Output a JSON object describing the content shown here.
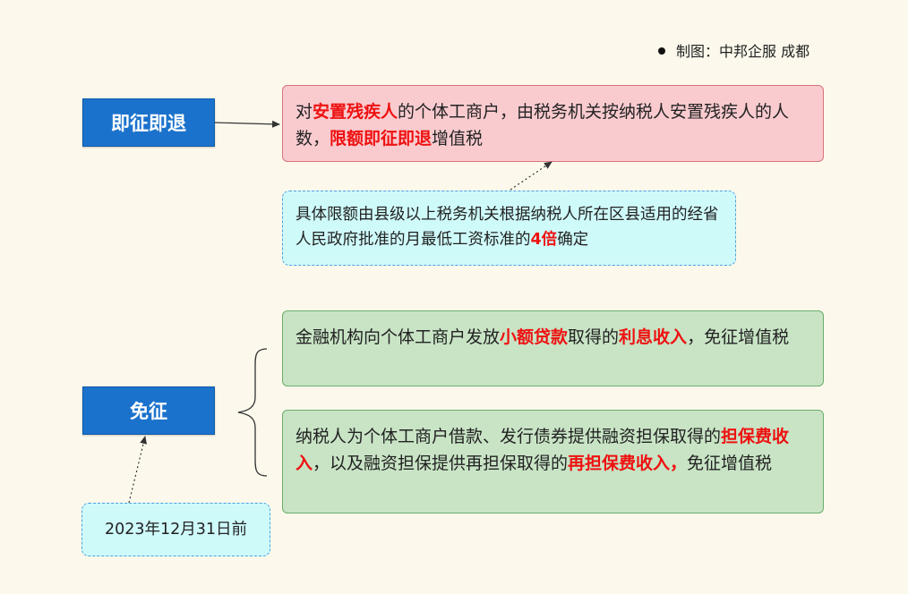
{
  "credit": "制图：中邦企服 成都",
  "labels": {
    "refund": "即征即退",
    "exempt": "免征"
  },
  "boxes": {
    "refund_main": [
      {
        "t": "对",
        "h": false
      },
      {
        "t": "安置残疾人",
        "h": true
      },
      {
        "t": "的个体工商户，由税务机关按纳税人安置残疾人的人数，",
        "h": false
      },
      {
        "t": "限额即征即退",
        "h": true
      },
      {
        "t": "增值税",
        "h": false
      }
    ],
    "refund_note": [
      {
        "t": "具体限额由县级以上税务机关根据纳税人所在区县适用的经省人民政府批准的月最低工资标准的",
        "h": false
      },
      {
        "t": "4倍",
        "h": true
      },
      {
        "t": "确定",
        "h": false
      }
    ],
    "exempt_1": [
      {
        "t": "金融机构向个体工商户发放",
        "h": false
      },
      {
        "t": "小额贷款",
        "h": true
      },
      {
        "t": "取得的",
        "h": false
      },
      {
        "t": "利息收入",
        "h": true
      },
      {
        "t": "，免征增值税",
        "h": false
      }
    ],
    "exempt_2": [
      {
        "t": "纳税人为个体工商户借款、发行债券提供融资担保取得的",
        "h": false
      },
      {
        "t": "担保费收入",
        "h": true
      },
      {
        "t": "，以及融资担保提供再担保取得的",
        "h": false
      },
      {
        "t": "再担保费收入，",
        "h": true
      },
      {
        "t": "免征增值税",
        "h": false
      }
    ],
    "exempt_note": "2023年12月31日前"
  },
  "colors": {
    "label_bg": "#1b72cc",
    "red_box_bg": "#f9cbcf",
    "green_box_bg": "#c8e4c5",
    "note_bg": "#cffafa",
    "highlight": "#ee1111"
  }
}
